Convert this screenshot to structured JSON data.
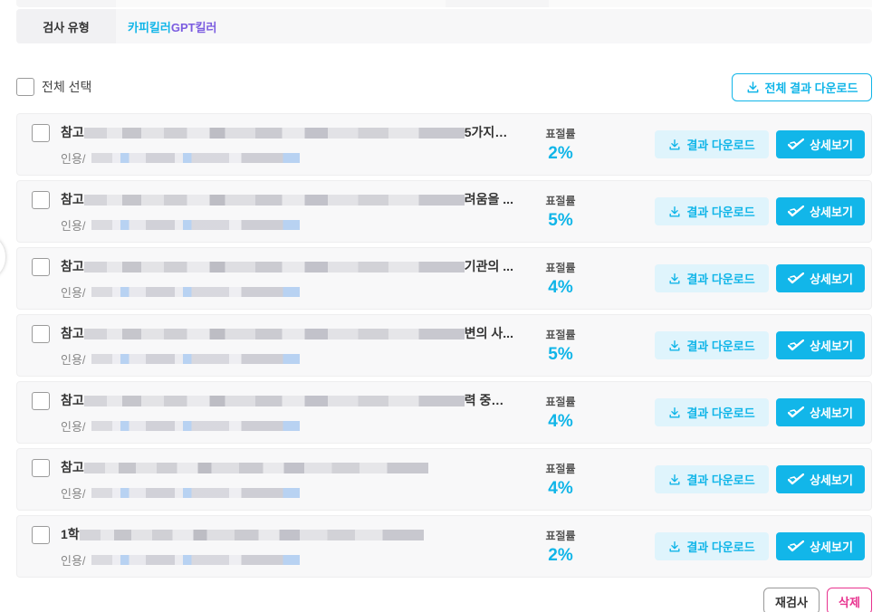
{
  "filter": {
    "type_label": "검사 유형",
    "type_value_a": "카피킬러",
    "type_value_b": "GPT킬러"
  },
  "toolbar": {
    "select_all_label": "전체 선택",
    "download_all_label": "전체 결과 다운로드"
  },
  "rows": [
    {
      "title_prefix": "참고",
      "title_suffix": "5가지를...",
      "sub_prefix": "인용/",
      "score_label": "표절률",
      "score": "2%"
    },
    {
      "title_prefix": "참고",
      "title_suffix": "려움을 ...",
      "sub_prefix": "인용/",
      "score_label": "표절률",
      "score": "5%"
    },
    {
      "title_prefix": "참고",
      "title_suffix": "기관의 ...",
      "sub_prefix": "인용/",
      "score_label": "표절률",
      "score": "4%"
    },
    {
      "title_prefix": "참고",
      "title_suffix": "변의 사...",
      "sub_prefix": "인용/",
      "score_label": "표절률",
      "score": "5%"
    },
    {
      "title_prefix": "참고",
      "title_suffix": "력 중에서...",
      "sub_prefix": "인용/",
      "score_label": "표절률",
      "score": "4%"
    },
    {
      "title_prefix": "참고",
      "title_suffix": "",
      "sub_prefix": "인용/",
      "score_label": "표절률",
      "score": "4%"
    },
    {
      "title_prefix": "1학",
      "title_suffix": "",
      "sub_prefix": "인용/",
      "score_label": "표절률",
      "score": "2%"
    }
  ],
  "row_buttons": {
    "download_label": "결과 다운로드",
    "detail_label": "상세보기"
  },
  "footer": {
    "recheck_label": "재검사",
    "delete_label": "삭제"
  },
  "colors": {
    "accent": "#12b6e9",
    "secondary": "#7b5ce0",
    "danger": "#e8338f"
  }
}
